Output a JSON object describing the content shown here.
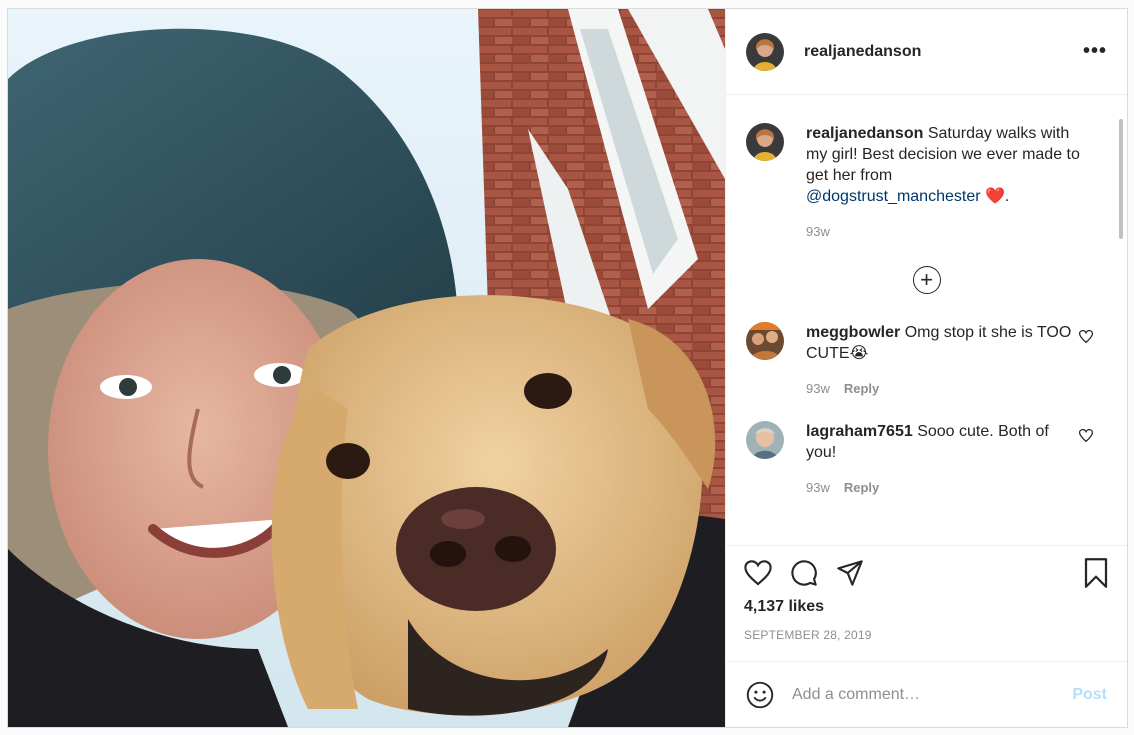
{
  "post": {
    "author": "realjanedanson",
    "photo_alt_icon": "selfie-photo",
    "more_icon": "more-horizontal-icon",
    "more_label": "•••"
  },
  "caption": {
    "author": "realjanedanson",
    "text": "Saturday walks with my girl! Best decision we ever made to get her from",
    "mention": "@dogstrust_manchester",
    "heart": "❤️",
    "end": ".",
    "time": "93w"
  },
  "load_more_icon": "plus-circle-icon",
  "load_more_glyph": "+",
  "comments": [
    {
      "author": "meggbowler",
      "text": "Omg stop it she is TOO CUTE",
      "emoji": "😭",
      "time": "93w",
      "reply": "Reply"
    },
    {
      "author": "lagraham7651",
      "text": "Sooo cute. Both of you!",
      "emoji": "",
      "time": "93w",
      "reply": "Reply"
    }
  ],
  "actions": {
    "likes": "4,137 likes",
    "date": "SEPTEMBER 28, 2019"
  },
  "add_comment": {
    "placeholder": "Add a comment…",
    "post_label": "Post"
  },
  "colors": {
    "link": "#00376b",
    "post_button_disabled": "#b2dffc",
    "heart": "#ed4956",
    "muted": "#8e8e8e"
  }
}
